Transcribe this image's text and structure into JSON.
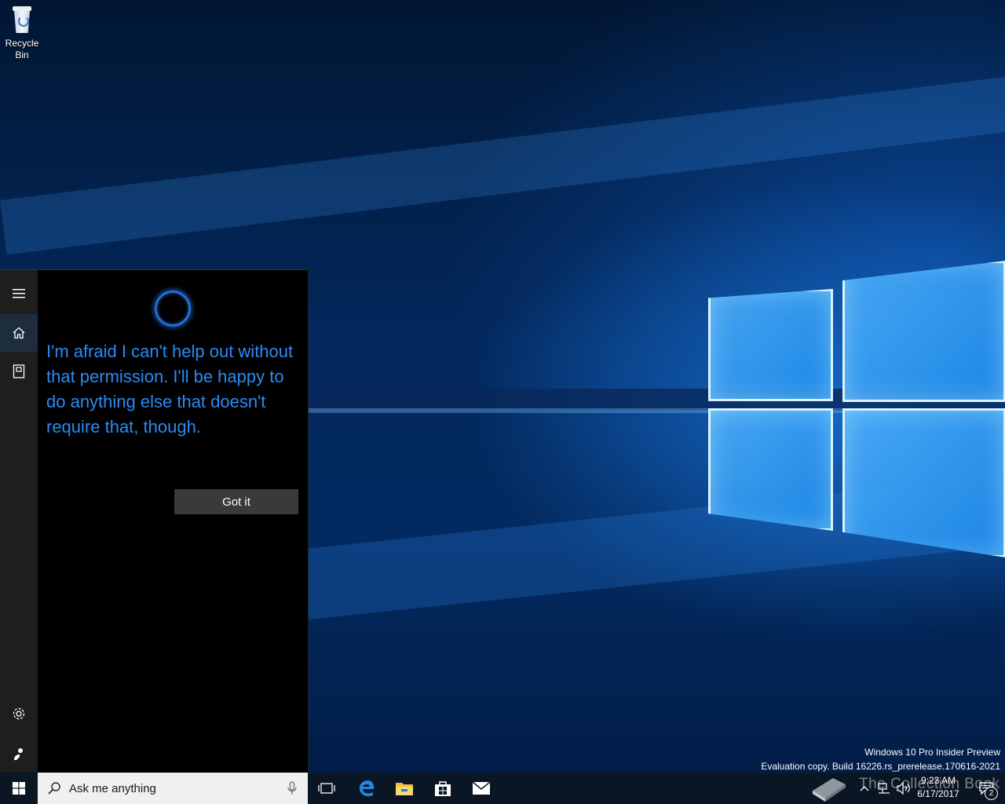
{
  "desktop": {
    "icons": [
      {
        "label": "Recycle Bin"
      }
    ],
    "watermark": {
      "line1": "Windows 10 Pro Insider Preview",
      "line2": "Evaluation copy. Build 16226.rs_prerelease.170616-2021"
    }
  },
  "cortana": {
    "rail": [
      "hamburger-menu-icon",
      "home-icon",
      "notebook-icon",
      "settings-icon",
      "feedback-icon"
    ],
    "message": "I'm afraid I can't help out without that permission. I'll be happy to do anything else that doesn't require that, though.",
    "button_label": "Got it",
    "accent_color": "#2a8bf5"
  },
  "taskbar": {
    "search_placeholder": "Ask me anything",
    "pinned": [
      "task-view-icon",
      "edge-icon",
      "file-explorer-icon",
      "store-icon",
      "mail-icon"
    ],
    "clock": {
      "time": "9:23 AM",
      "date": "6/17/2017"
    },
    "notification_count": "2",
    "overlay_text": "The Collection Book"
  }
}
